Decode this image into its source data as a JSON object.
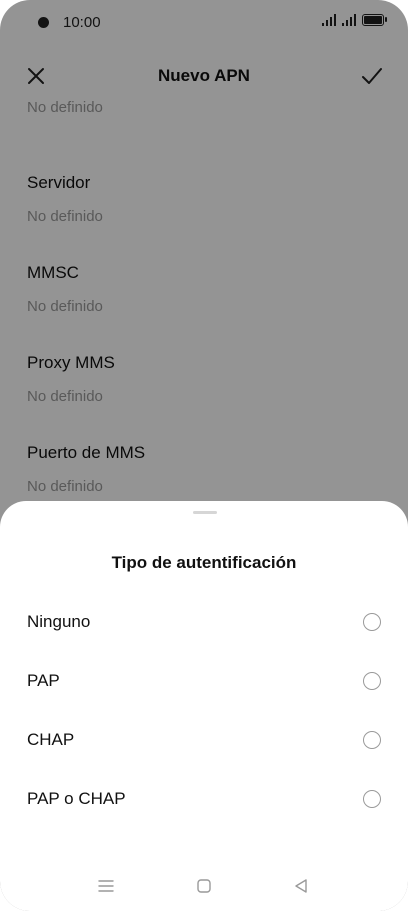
{
  "status_bar": {
    "time": "10:00"
  },
  "app_bar": {
    "title": "Nuevo APN",
    "close_icon": "close-icon",
    "confirm_icon": "check-icon"
  },
  "fields": [
    {
      "label": "",
      "value": "No definido"
    },
    {
      "label": "Servidor",
      "value": "No definido"
    },
    {
      "label": "MMSC",
      "value": "No definido"
    },
    {
      "label": "Proxy MMS",
      "value": "No definido"
    },
    {
      "label": "Puerto de MMS",
      "value": "No definido"
    }
  ],
  "sheet": {
    "title": "Tipo de autentificación",
    "options": [
      {
        "label": "Ninguno",
        "selected": false
      },
      {
        "label": "PAP",
        "selected": false
      },
      {
        "label": "CHAP",
        "selected": false
      },
      {
        "label": "PAP o CHAP",
        "selected": false
      }
    ]
  },
  "nav_bar": {
    "menu_icon": "menu-icon",
    "home_icon": "home-icon",
    "back_icon": "back-icon"
  }
}
